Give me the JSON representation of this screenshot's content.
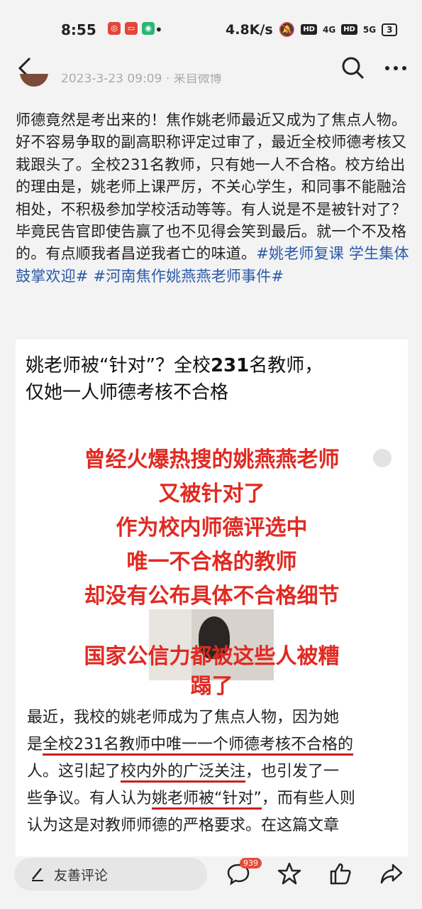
{
  "status": {
    "time": "8:55",
    "network_speed": "4.8K/s",
    "hd1": "HD",
    "net1": "4G",
    "hd2": "HD",
    "net2": "5G",
    "battery": "3"
  },
  "author": {
    "meta": "2023-3-23 09:09 · 来自微博"
  },
  "post": {
    "text": "师德竟然是考出来的！焦作姚老师最近又成为了焦点人物。好不容易争取的副高职称评定过审了，最近全校师德考核又栽跟头了。全校231名教师，只有她一人不合格。校方给出的理由是，姚老师上课严厉，不关心学生，和同事不能融洽相处，不积极参加学校活动等等。有人说是不是被针对了？毕竟民告官即使告赢了也不见得会笑到最后。就一个不及格的。有点顺我者昌逆我者亡的味道。",
    "hashtag1": "#姚老师复课 学生集体鼓掌欢迎#",
    "hashtag2": "#河南焦作姚燕燕老师事件#"
  },
  "card": {
    "title_a": "姚老师被“针对”？全校",
    "title_num": "231",
    "title_b": "名教师，",
    "title_line2": "仅她一人师德考核不合格",
    "red_line1": "曾经火爆热搜的姚燕燕老师",
    "red_line2": "又被针对了",
    "red_line3": "作为校内师德评选中",
    "red_line4": "唯一不合格的教师",
    "red_line5": "却没有公布具体不合格细节",
    "red_line6": "国家公信力都被这些人被糟",
    "red_line7": "蹋了",
    "article_1": "最近，我校的姚老师成为了焦点人物，因为她",
    "article_2a": "是",
    "article_2u": "全校231名教师中唯一一个师德考核不合格的",
    "article_3a": "人。这引起了",
    "article_3u": "校内外的广泛关注",
    "article_3b": "，也引发了一",
    "article_4a": "些争议。有人认为",
    "article_4u": "姚老师被“针对”",
    "article_4b": "，而有些人则",
    "article_5": "认为这是对教师师德的严格要求。在这篇文章"
  },
  "bottom": {
    "comment_placeholder": "友善评论",
    "comment_count": "939"
  }
}
